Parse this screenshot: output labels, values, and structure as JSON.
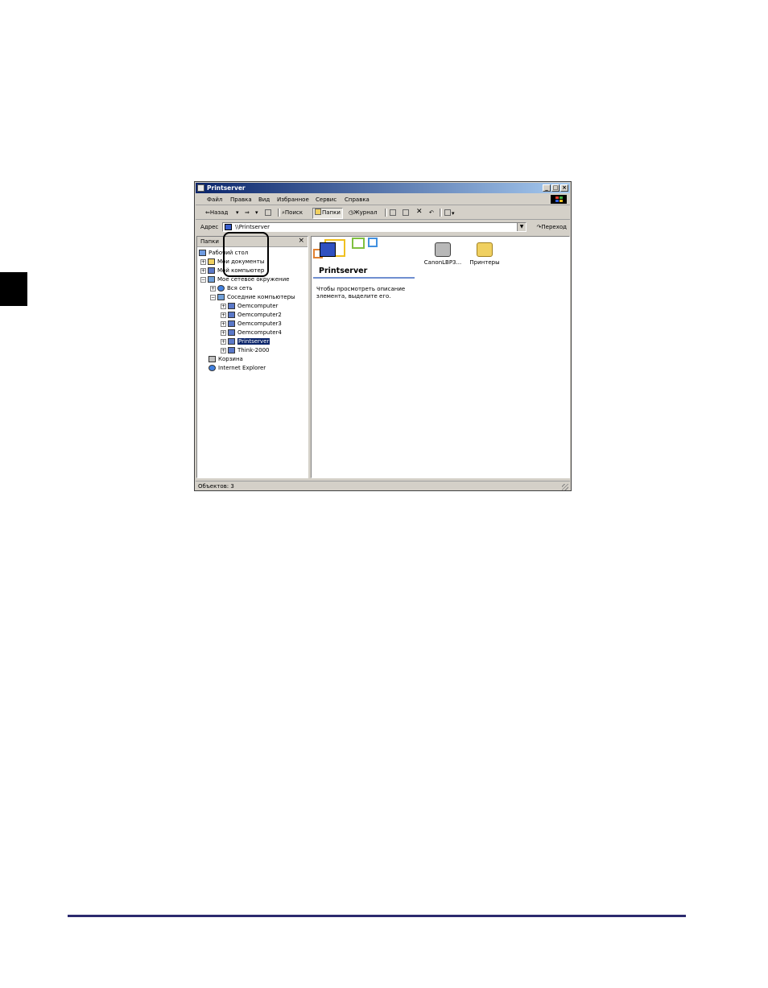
{
  "window": {
    "title": "Printserver",
    "controls": {
      "minimize": "_",
      "maximize": "□",
      "close": "×"
    }
  },
  "menu": [
    "Файл",
    "Правка",
    "Вид",
    "Избранное",
    "Сервис",
    "Справка"
  ],
  "toolbar": {
    "back": "Назад",
    "search": "Поиск",
    "folders": "Папки",
    "history": "Журнал"
  },
  "address": {
    "label": "Адрес",
    "value": "\\\\Printserver",
    "go": "Переход"
  },
  "folders_panel": {
    "title": "Папки",
    "close": "×",
    "tree": [
      {
        "label": "Рабочий стол",
        "icon": "desktop-icon"
      },
      {
        "label": "Мои документы",
        "icon": "folder-icon"
      },
      {
        "label": "Мой компьютер",
        "icon": "computer-icon"
      },
      {
        "label": "Мое сетевое окружение",
        "icon": "network-icon"
      },
      {
        "label": "Вся сеть",
        "icon": "globe-icon"
      },
      {
        "label": "Соседние компьютеры",
        "icon": "network-icon"
      },
      {
        "label": "Oemcomputer",
        "icon": "computer-icon"
      },
      {
        "label": "Oemcomputer2",
        "icon": "computer-icon"
      },
      {
        "label": "Oemcomputer3",
        "icon": "computer-icon"
      },
      {
        "label": "Oemcomputer4",
        "icon": "computer-icon"
      },
      {
        "label": "Printserver",
        "icon": "computer-icon",
        "selected": true
      },
      {
        "label": "Think-2000",
        "icon": "computer-icon"
      },
      {
        "label": "Корзина",
        "icon": "recycle-bin-icon"
      },
      {
        "label": "Internet Explorer",
        "icon": "ie-icon"
      }
    ]
  },
  "content": {
    "heading": "Printserver",
    "description": "Чтобы просмотреть описание элемента, выделите его.",
    "items": [
      {
        "label": "CanonLBP3...",
        "icon": "shared-printer-icon"
      },
      {
        "label": "Принтеры",
        "icon": "printers-folder-icon"
      }
    ]
  },
  "status": "Объектов: 3",
  "colors": {
    "titlebar": "#0a246a",
    "selection": "#0a246a",
    "rule": "#2b2a6e"
  }
}
